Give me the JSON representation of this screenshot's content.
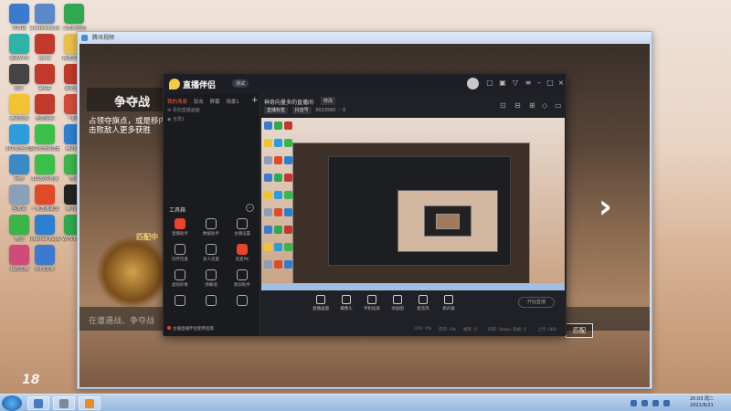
{
  "desktop": {
    "icons": [
      {
        "label": "计算机",
        "color": "#3c7ad0"
      },
      {
        "label": "shadowsocks",
        "color": "#5a88c8"
      },
      {
        "label": "三角洲行动",
        "color": "#2fa84f"
      },
      {
        "label": "慕名VPN",
        "color": "#2fb3a8"
      },
      {
        "label": "zp.dz",
        "color": "#c0392b"
      },
      {
        "label": "新建文件夹",
        "color": "#e7c04a"
      },
      {
        "label": "图片",
        "color": "#444444"
      },
      {
        "label": "第6章",
        "color": "#c0392b"
      },
      {
        "label": "最新游戏",
        "color": "#c0392b"
      },
      {
        "label": "腾讯视频",
        "color": "#f2c230"
      },
      {
        "label": "全能视频",
        "color": "#c0392b"
      },
      {
        "label": "一起来",
        "color": "#d04a3a"
      },
      {
        "label": "360安全卫士",
        "color": "#2d9cdb"
      },
      {
        "label": "360安全浏览器",
        "color": "#3ac04a"
      },
      {
        "label": "腾讯QQ",
        "color": "#2d7fd0"
      },
      {
        "label": "网络",
        "color": "#3a8ac8"
      },
      {
        "label": "360软件管家",
        "color": "#3ac04a"
      },
      {
        "label": "微信",
        "color": "#3ab54a"
      },
      {
        "label": "回收站",
        "color": "#8aa0b8"
      },
      {
        "label": "一条直播录屏",
        "color": "#e04a2a"
      },
      {
        "label": "腾讯QQ",
        "color": "#222222"
      },
      {
        "label": "微信",
        "color": "#3ab54a"
      },
      {
        "label": "Internet Explorer",
        "color": "#2d7fd0"
      },
      {
        "label": "WPS Excel",
        "color": "#2fa84f"
      },
      {
        "label": "我的文档",
        "color": "#d04a7a"
      },
      {
        "label": "WPS文字",
        "color": "#3c7ad0"
      }
    ]
  },
  "outer_window": {
    "title": "腾讯视频",
    "game_title": "争夺战",
    "game_desc": "占领夺旗点，或是移内击败敌人更多获胜",
    "match_label": "匹配中",
    "bottom_text": "在遭遇战、争夺战",
    "right_button": "匹配"
  },
  "live_app": {
    "name": "直播伴侣",
    "version": "测试",
    "sidebar": {
      "tabs": [
        "我的场景",
        "双击",
        "屏幕",
        "场景1"
      ],
      "active_tab": "我的场景",
      "scene_items": [
        "添加直播画面",
        "全屏1"
      ],
      "tools_title": "工具箱",
      "tools": [
        {
          "label": "直播助手",
          "highlight": true
        },
        {
          "label": "数据助手",
          "highlight": false
        },
        {
          "label": "主播设置",
          "highlight": false
        },
        {
          "label": "玩伴连麦",
          "highlight": false
        },
        {
          "label": "多人连麦",
          "highlight": false
        },
        {
          "label": "连麦PK",
          "highlight": true
        },
        {
          "label": "虚拟形象",
          "highlight": false
        },
        {
          "label": "弹幕墙",
          "highlight": false
        },
        {
          "label": "歌词助手",
          "highlight": false
        },
        {
          "label": "",
          "highlight": false
        },
        {
          "label": "",
          "highlight": false
        },
        {
          "label": "",
          "highlight": false
        }
      ],
      "notice": "主播直播伴侣使用指南"
    },
    "main": {
      "title": "神奇向量多的直播间",
      "edit_label": "修改",
      "tags": [
        "直播标签",
        "抖音号"
      ],
      "room_id": "0023560",
      "likes": "0",
      "bottom_tools": [
        "直播画面",
        "摄像头",
        "手机投屏",
        "添加图",
        "麦克风",
        "扬声器"
      ],
      "go_live": "开始直播",
      "status": [
        "CPU: 0%",
        "内存: 0%",
        "帧率: 0",
        "码率: 0kbps",
        "丢帧: 0",
        "上行: 0KB"
      ]
    }
  },
  "taskbar": {
    "clock_time": "20:03 周二",
    "clock_date": "2021/6/21",
    "items": [
      {
        "color": "#4a7ac0"
      },
      {
        "color": "#7a8a9a"
      },
      {
        "color": "#e88a2a"
      }
    ]
  },
  "watermark": "18"
}
